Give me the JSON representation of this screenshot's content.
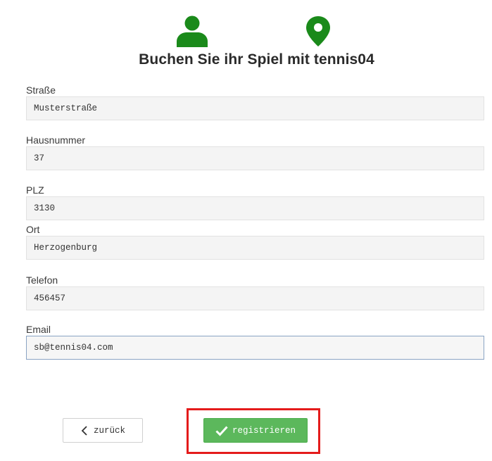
{
  "header": {
    "icons": [
      "user-icon",
      "location-pin-icon"
    ],
    "title": "Buchen Sie ihr Spiel mit tennis04",
    "accent_color": "#1a8a1a"
  },
  "form": {
    "fields": [
      {
        "label": "Straße",
        "value": "Musterstraße"
      },
      {
        "label": "Hausnummer",
        "value": "37"
      },
      {
        "label": "PLZ",
        "value": "3130"
      },
      {
        "label": "Ort",
        "value": "Herzogenburg"
      },
      {
        "label": "Telefon",
        "value": "456457"
      },
      {
        "label": "Email",
        "value": "sb@tennis04.com"
      }
    ]
  },
  "actions": {
    "back_label": "zurück",
    "register_label": "registrieren",
    "register_color": "#5cb85c",
    "highlight_color": "#e41b1b"
  }
}
